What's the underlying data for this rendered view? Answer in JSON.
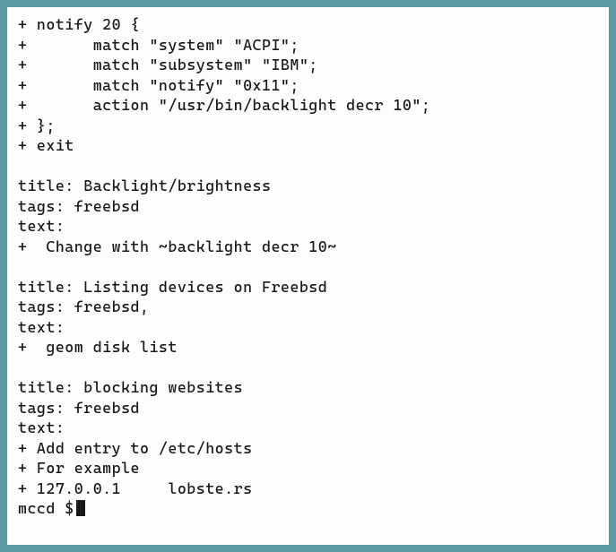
{
  "lines": [
    "+ notify 20 {",
    "+       match \"system\" \"ACPI\";",
    "+       match \"subsystem\" \"IBM\";",
    "+       match \"notify\" \"0x11\";",
    "+       action \"/usr/bin/backlight decr 10\";",
    "+ };",
    "+ exit",
    "",
    "title: Backlight/brightness",
    "tags: freebsd",
    "text:",
    "+  Change with ~backlight decr 10~",
    "",
    "title: Listing devices on Freebsd",
    "tags: freebsd,",
    "text:",
    "+  geom disk list",
    "",
    "title: blocking websites",
    "tags: freebsd",
    "text:",
    "+ Add entry to /etc/hosts",
    "+ For example",
    "+ 127.0.0.1     lobste.rs"
  ],
  "prompt": "mccd $ "
}
